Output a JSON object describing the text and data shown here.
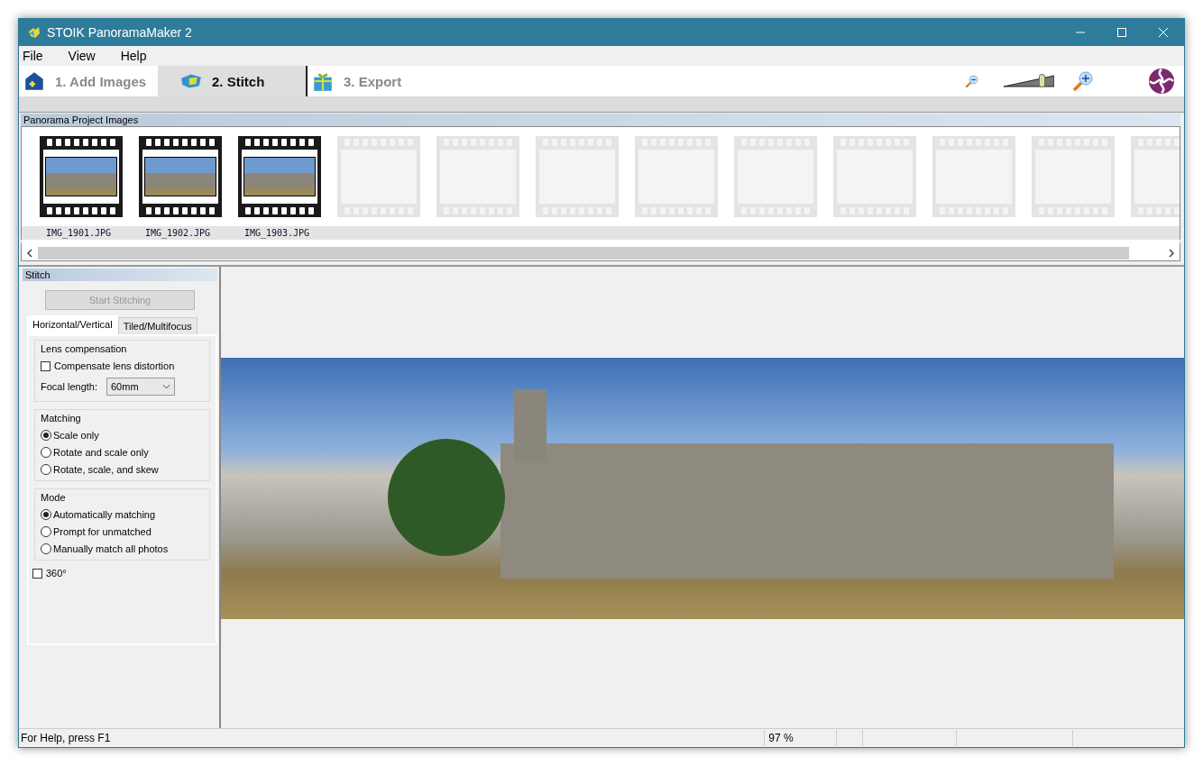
{
  "window": {
    "title": "STOIK PanoramaMaker 2"
  },
  "menu": [
    "File",
    "View",
    "Help"
  ],
  "steps": [
    {
      "label": "1. Add Images",
      "selected": false,
      "kind": "add"
    },
    {
      "label": "2. Stitch",
      "selected": true,
      "kind": "stitch"
    },
    {
      "label": "3. Export",
      "selected": false,
      "kind": "export"
    }
  ],
  "zoom": {
    "level": 0.75
  },
  "images_panel": {
    "title": "Panorama Project Images",
    "images": [
      "IMG_1901.JPG",
      "IMG_1902.JPG",
      "IMG_1903.JPG"
    ]
  },
  "stitch_panel": {
    "title": "Stitch",
    "button": {
      "label": "Start Stitching",
      "disabled": true
    },
    "tabs": [
      {
        "label": "Horizontal/Vertical",
        "selected": true
      },
      {
        "label": "Tiled/Multifocus",
        "selected": false
      }
    ],
    "lens": {
      "title": "Lens compensation",
      "compensate": {
        "label": "Compensate lens distortion",
        "checked": false
      },
      "focal_label": "Focal length:",
      "focal_value": "60mm"
    },
    "matching": {
      "title": "Matching",
      "options": [
        {
          "label": "Scale only",
          "selected": true
        },
        {
          "label": "Rotate and scale only",
          "selected": false
        },
        {
          "label": "Rotate, scale, and skew",
          "selected": false
        }
      ]
    },
    "mode": {
      "title": "Mode",
      "options": [
        {
          "label": "Automatically matching",
          "selected": true
        },
        {
          "label": "Prompt for unmatched",
          "selected": false
        },
        {
          "label": "Manually match all photos",
          "selected": false
        }
      ]
    },
    "full_circle": {
      "label": "360°",
      "checked": false
    }
  },
  "status_bar": {
    "help": "For Help, press F1",
    "zoom": "97 %"
  }
}
